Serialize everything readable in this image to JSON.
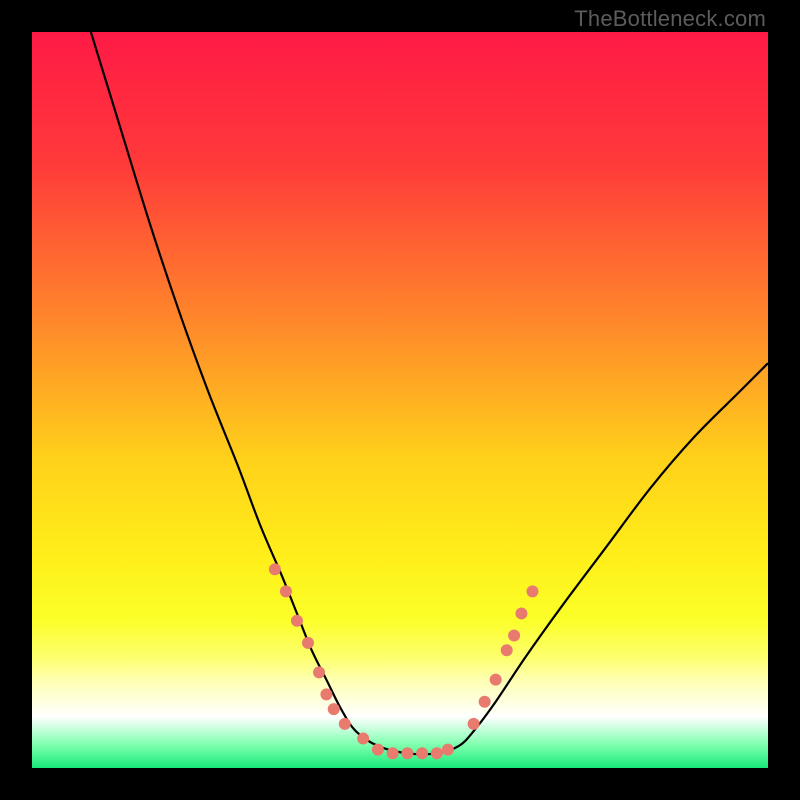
{
  "watermark": "TheBottleneck.com",
  "chart_data": {
    "type": "line",
    "title": "",
    "xlabel": "",
    "ylabel": "",
    "xlim": [
      0,
      100
    ],
    "ylim": [
      0,
      100
    ],
    "gradient_stops": [
      {
        "offset": 0,
        "color": "#ff1a46"
      },
      {
        "offset": 18,
        "color": "#ff3a3a"
      },
      {
        "offset": 40,
        "color": "#ff8a2a"
      },
      {
        "offset": 58,
        "color": "#ffd11a"
      },
      {
        "offset": 72,
        "color": "#fff01a"
      },
      {
        "offset": 80,
        "color": "#fbff2a"
      },
      {
        "offset": 85,
        "color": "#fdff6e"
      },
      {
        "offset": 88,
        "color": "#feffb0"
      },
      {
        "offset": 93,
        "color": "#ffffff"
      },
      {
        "offset": 97,
        "color": "#7affab"
      },
      {
        "offset": 100,
        "color": "#17e87a"
      }
    ],
    "series": [
      {
        "name": "bottleneck-curve",
        "x": [
          8,
          12,
          16,
          20,
          24,
          28,
          31,
          34,
          36,
          38,
          40,
          42,
          44,
          47,
          51,
          55,
          58,
          60,
          63,
          67,
          72,
          78,
          84,
          90,
          96,
          100
        ],
        "y": [
          100,
          87,
          74,
          62,
          51,
          41,
          33,
          26,
          21,
          16,
          12,
          8,
          5,
          3,
          2,
          2,
          3,
          5,
          9,
          15,
          22,
          30,
          38,
          45,
          51,
          55
        ]
      }
    ],
    "markers": {
      "comment": "Salmon dotted markers along lower V",
      "color": "#e87a6e",
      "radius": 6,
      "points": [
        {
          "x": 33,
          "y": 27
        },
        {
          "x": 34.5,
          "y": 24
        },
        {
          "x": 36,
          "y": 20
        },
        {
          "x": 37.5,
          "y": 17
        },
        {
          "x": 39,
          "y": 13
        },
        {
          "x": 40,
          "y": 10
        },
        {
          "x": 41,
          "y": 8
        },
        {
          "x": 42.5,
          "y": 6
        },
        {
          "x": 45,
          "y": 4
        },
        {
          "x": 47,
          "y": 2.5
        },
        {
          "x": 49,
          "y": 2
        },
        {
          "x": 51,
          "y": 2
        },
        {
          "x": 53,
          "y": 2
        },
        {
          "x": 55,
          "y": 2
        },
        {
          "x": 56.5,
          "y": 2.5
        },
        {
          "x": 60,
          "y": 6
        },
        {
          "x": 61.5,
          "y": 9
        },
        {
          "x": 63,
          "y": 12
        },
        {
          "x": 64.5,
          "y": 16
        },
        {
          "x": 65.5,
          "y": 18
        },
        {
          "x": 66.5,
          "y": 21
        },
        {
          "x": 68,
          "y": 24
        }
      ]
    }
  }
}
